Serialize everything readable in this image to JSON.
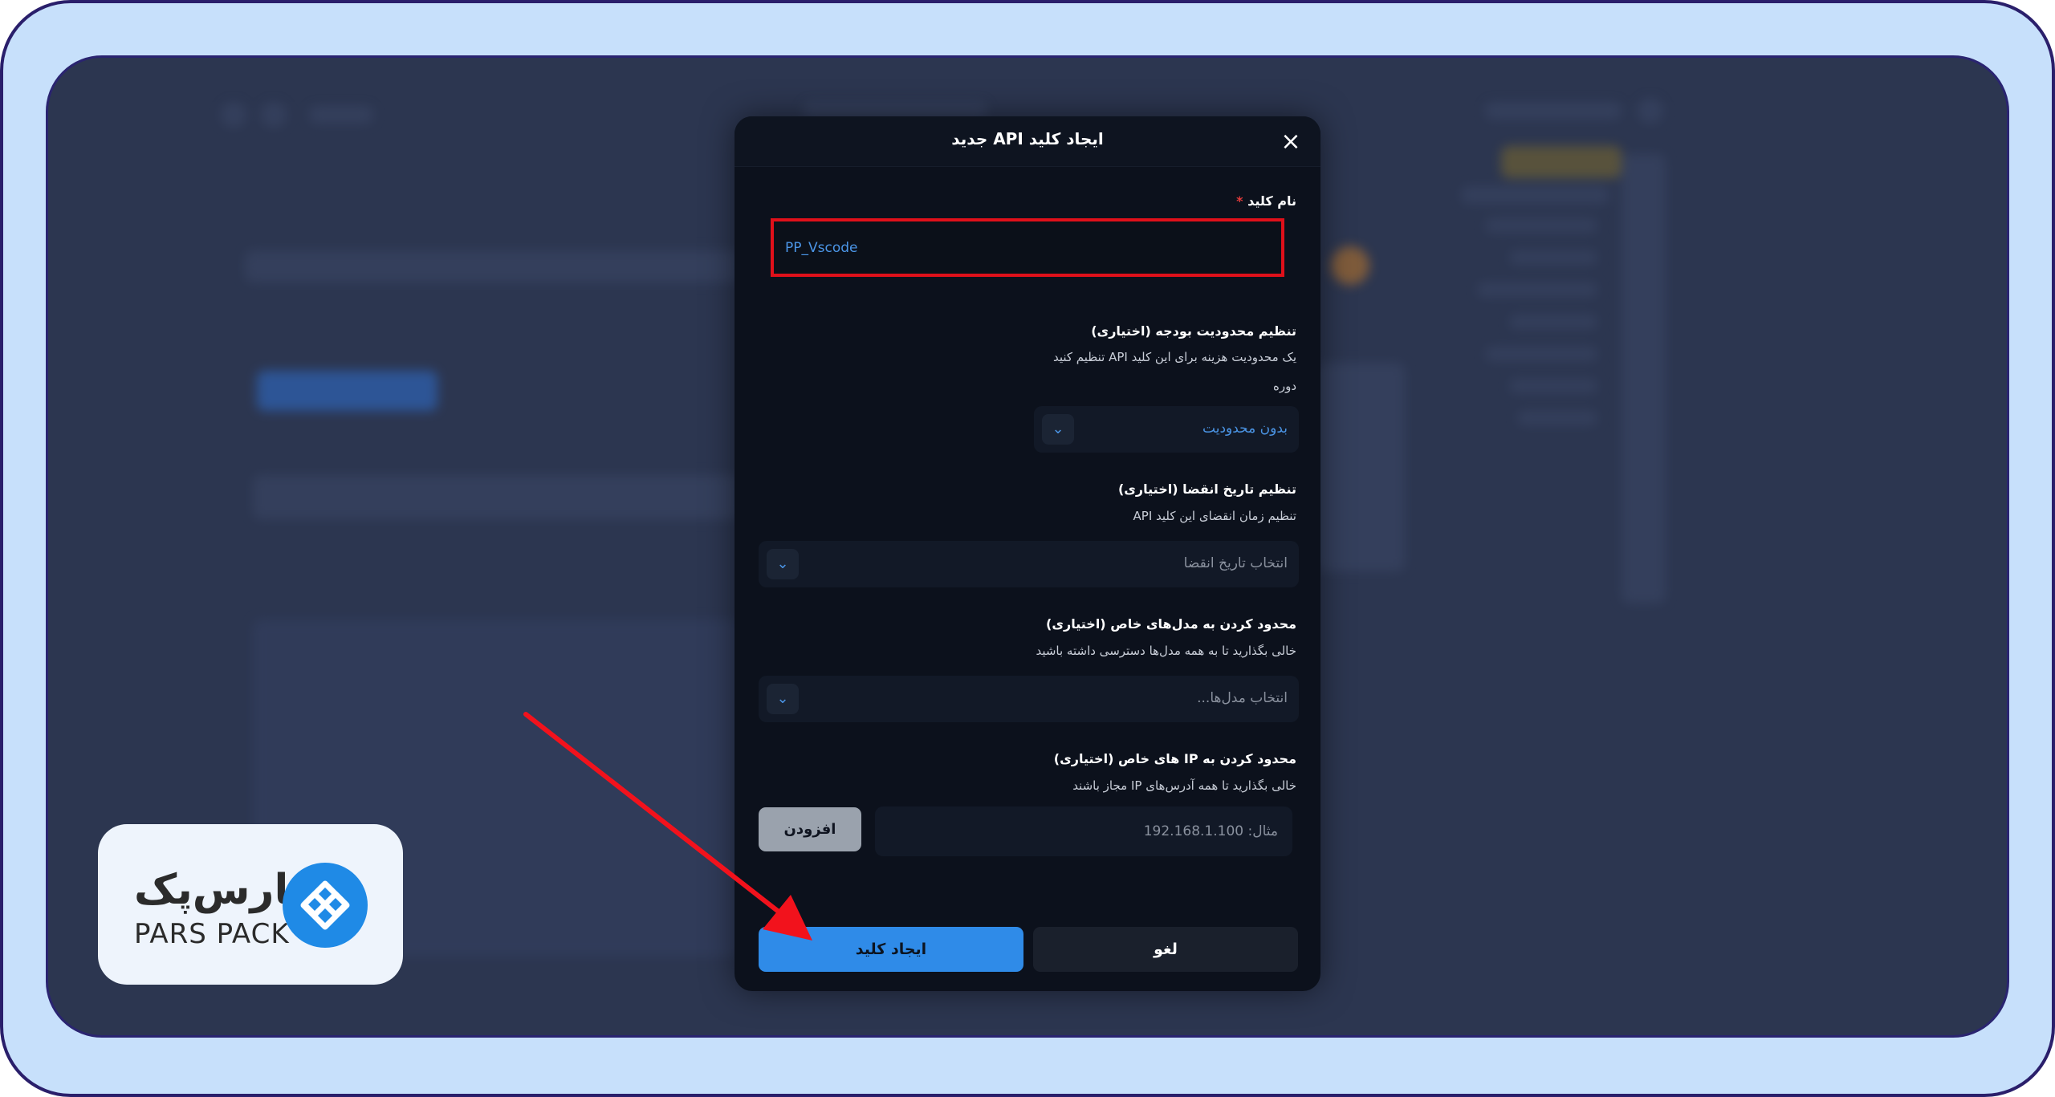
{
  "modal": {
    "title": "ایجاد کلید API جدید",
    "close_icon": "close-icon",
    "key_name": {
      "label": "نام کلید",
      "required_mark": "*",
      "value": "PP_Vscode"
    },
    "budget": {
      "title": "تنظیم محدودیت بودجه (اختیاری)",
      "hint": "یک محدودیت هزینه برای این کلید API تنظیم کنید",
      "period_label": "دوره",
      "selected": "بدون محدودیت"
    },
    "expiry": {
      "title": "تنظیم تاریخ انقضا (اختیاری)",
      "hint": "تنظیم زمان انقضای این کلید API",
      "placeholder": "انتخاب تاریخ انقضا"
    },
    "models": {
      "title": "محدود کردن به مدل‌های خاص (اختیاری)",
      "hint": "خالی بگذارید تا به همه مدل‌ها دسترسی داشته باشید",
      "placeholder": "انتخاب مدل‌ها..."
    },
    "ips": {
      "title": "محدود کردن به IP های خاص (اختیاری)",
      "hint": "خالی بگذارید تا همه آدرس‌های IP مجاز باشند",
      "placeholder": "مثال: 192.168.1.100",
      "add_label": "افزودن"
    },
    "buttons": {
      "create": "ایجاد کلید",
      "cancel": "لغو"
    }
  },
  "logo": {
    "fa": "پارس‌پک",
    "en": "PARS PACK"
  },
  "colors": {
    "accent": "#2f8be8",
    "highlight": "#e0101a",
    "frame_bg": "#c7e0fb"
  }
}
